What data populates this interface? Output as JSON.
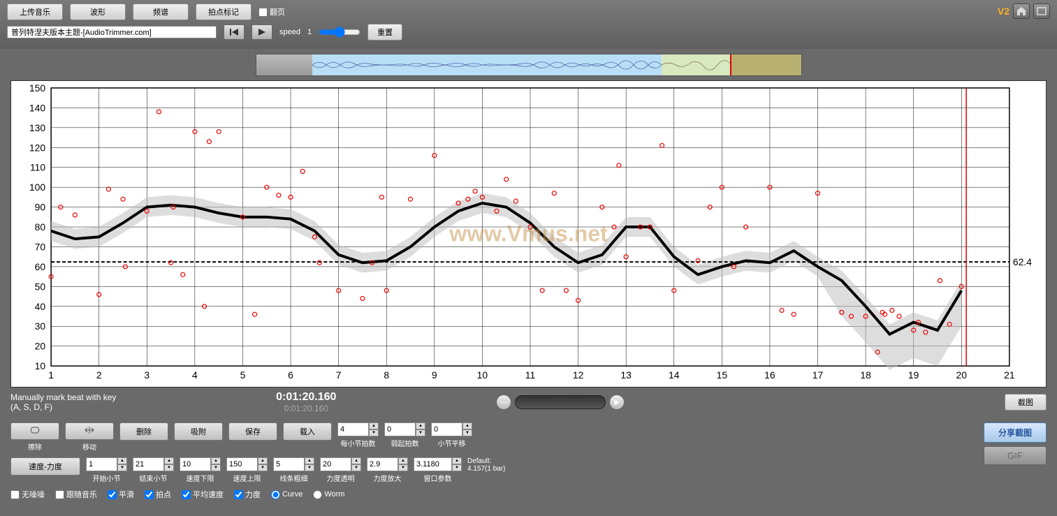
{
  "toolbar": {
    "upload": "上传音乐",
    "waveform": "波形",
    "spectrum": "频谱",
    "beatmark": "拍点标记",
    "flip": "翻页",
    "filename": "普列特涅夫版本主题-[AudioTrimmer.com]",
    "speed_label": "speed",
    "speed_value": "1",
    "reset": "重置"
  },
  "topright": {
    "version": "V2"
  },
  "status": {
    "hint_line1": "Manually mark beat with key",
    "hint_line2": "(A, S, D, F)",
    "time1": "0:01:20.160",
    "time2": "0:01:20.160",
    "screenshot": "截图"
  },
  "tools": {
    "erase": "擦除",
    "move": "移动",
    "delete": "删除",
    "snap": "吸附",
    "save": "保存",
    "load": "载入",
    "speed_dyn": "速度-力度"
  },
  "spinners": {
    "beats_per_bar": {
      "value": "4",
      "label": "每小节拍数"
    },
    "pickup": {
      "value": "0",
      "label": "弱起拍数"
    },
    "bar_offset": {
      "value": "0",
      "label": "小节平移"
    },
    "start_bar": {
      "value": "1",
      "label": "开始小节"
    },
    "end_bar": {
      "value": "21",
      "label": "结束小节"
    },
    "speed_min": {
      "value": "10",
      "label": "速度下限"
    },
    "speed_max": {
      "value": "150",
      "label": "速度上限"
    },
    "line_width": {
      "value": "5",
      "label": "线条粗细"
    },
    "dyn_alpha": {
      "value": "20",
      "label": "力度透明"
    },
    "dyn_scale": {
      "value": "2.9",
      "label": "力度放大"
    },
    "window": {
      "value": "3.1180",
      "label": "窗口参数"
    }
  },
  "default_text": {
    "label": "Default:",
    "value": "4.157(1 bar)"
  },
  "checkboxes": {
    "no_noise": "无噪噪",
    "follow_music": "跟随音乐",
    "smooth": "平滑",
    "beats": "拍点",
    "avg_speed": "平均速度",
    "dynamics": "力度",
    "curve": "Curve",
    "worm": "Worm"
  },
  "buttons": {
    "share": "分享截图",
    "gif": "GIF"
  },
  "watermark": "www.Vmus.net",
  "chart_data": {
    "type": "line",
    "xlim": [
      1,
      21
    ],
    "ylim": [
      10,
      150
    ],
    "xticks": [
      1,
      2,
      3,
      4,
      5,
      6,
      7,
      8,
      9,
      10,
      11,
      12,
      13,
      14,
      15,
      16,
      17,
      18,
      19,
      20,
      21
    ],
    "yticks": [
      10,
      20,
      30,
      40,
      50,
      60,
      70,
      80,
      90,
      100,
      110,
      120,
      130,
      140,
      150
    ],
    "avg_line": 62.4,
    "avg_label": "62.4",
    "curve": [
      [
        1,
        78
      ],
      [
        1.5,
        74
      ],
      [
        2,
        75
      ],
      [
        2.5,
        82
      ],
      [
        3,
        90
      ],
      [
        3.5,
        91
      ],
      [
        4,
        90
      ],
      [
        4.5,
        87
      ],
      [
        5,
        85
      ],
      [
        5.5,
        85
      ],
      [
        6,
        84
      ],
      [
        6.5,
        78
      ],
      [
        7,
        66
      ],
      [
        7.5,
        62
      ],
      [
        8,
        63
      ],
      [
        8.5,
        70
      ],
      [
        9,
        80
      ],
      [
        9.5,
        88
      ],
      [
        10,
        92
      ],
      [
        10.5,
        90
      ],
      [
        11,
        82
      ],
      [
        11.5,
        70
      ],
      [
        12,
        62
      ],
      [
        12.5,
        66
      ],
      [
        13,
        80
      ],
      [
        13.5,
        80
      ],
      [
        14,
        65
      ],
      [
        14.5,
        56
      ],
      [
        15,
        60
      ],
      [
        15.5,
        63
      ],
      [
        16,
        62
      ],
      [
        16.5,
        68
      ],
      [
        17,
        60
      ],
      [
        17.5,
        53
      ],
      [
        18,
        40
      ],
      [
        18.5,
        26
      ],
      [
        19,
        32
      ],
      [
        19.5,
        28
      ],
      [
        20,
        48
      ]
    ],
    "scatter": [
      [
        1,
        55
      ],
      [
        1.2,
        90
      ],
      [
        1.5,
        86
      ],
      [
        2,
        46
      ],
      [
        2.2,
        99
      ],
      [
        2.5,
        94
      ],
      [
        2.55,
        60
      ],
      [
        3,
        88
      ],
      [
        3.25,
        138
      ],
      [
        3.5,
        62
      ],
      [
        3.55,
        90
      ],
      [
        3.75,
        56
      ],
      [
        4,
        128
      ],
      [
        4.2,
        40
      ],
      [
        4.3,
        123
      ],
      [
        4.5,
        128
      ],
      [
        5,
        85
      ],
      [
        5.25,
        36
      ],
      [
        5.5,
        100
      ],
      [
        5.75,
        96
      ],
      [
        6,
        95
      ],
      [
        6.25,
        108
      ],
      [
        6.5,
        75
      ],
      [
        6.6,
        62
      ],
      [
        7,
        48
      ],
      [
        7.5,
        44
      ],
      [
        7.7,
        62
      ],
      [
        7.9,
        95
      ],
      [
        8,
        48
      ],
      [
        8.5,
        94
      ],
      [
        9,
        116
      ],
      [
        9.5,
        92
      ],
      [
        9.7,
        94
      ],
      [
        9.85,
        98
      ],
      [
        10,
        95
      ],
      [
        10.3,
        88
      ],
      [
        10.5,
        104
      ],
      [
        10.7,
        93
      ],
      [
        11,
        80
      ],
      [
        11.25,
        48
      ],
      [
        11.5,
        97
      ],
      [
        11.75,
        48
      ],
      [
        12,
        43
      ],
      [
        12.5,
        90
      ],
      [
        12.75,
        80
      ],
      [
        12.85,
        111
      ],
      [
        13,
        65
      ],
      [
        13.3,
        80
      ],
      [
        13.5,
        80
      ],
      [
        13.75,
        121
      ],
      [
        14,
        48
      ],
      [
        14.5,
        63
      ],
      [
        14.75,
        90
      ],
      [
        15,
        100
      ],
      [
        15.25,
        60
      ],
      [
        15.5,
        80
      ],
      [
        16,
        100
      ],
      [
        16.25,
        38
      ],
      [
        16.5,
        36
      ],
      [
        17,
        97
      ],
      [
        17.5,
        37
      ],
      [
        17.7,
        35
      ],
      [
        18,
        35
      ],
      [
        18.25,
        17
      ],
      [
        18.35,
        37
      ],
      [
        18.4,
        36
      ],
      [
        18.55,
        38
      ],
      [
        18.7,
        35
      ],
      [
        19,
        28
      ],
      [
        19.1,
        32
      ],
      [
        19.25,
        27
      ],
      [
        19.55,
        53
      ],
      [
        19.75,
        31
      ],
      [
        20,
        50
      ]
    ],
    "marker_x": 20.1
  }
}
